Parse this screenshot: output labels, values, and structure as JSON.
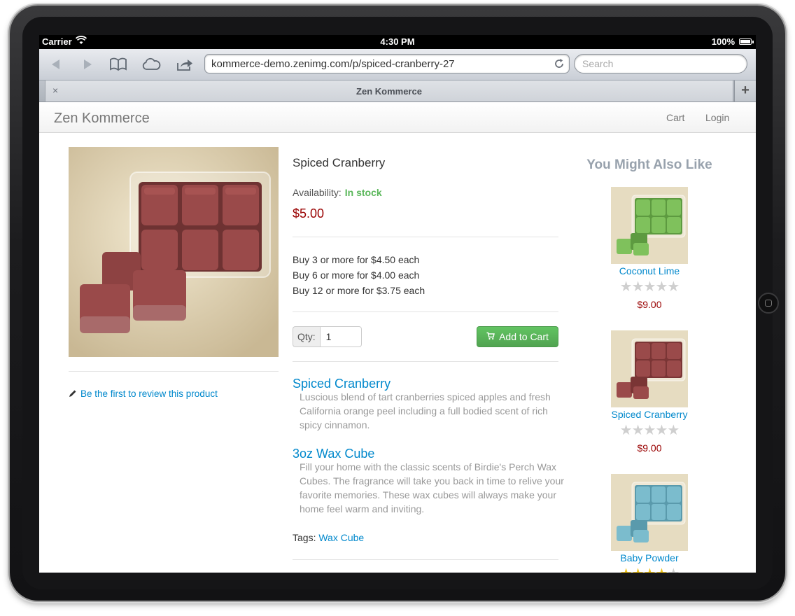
{
  "statusbar": {
    "carrier": "Carrier",
    "time": "4:30 PM",
    "battery": "100%"
  },
  "browser": {
    "url": "kommerce-demo.zenimg.com/p/spiced-cranberry-27",
    "search_placeholder": "Search",
    "tab_title": "Zen Kommerce",
    "tab_close": "×",
    "tab_add": "+"
  },
  "navbar": {
    "brand": "Zen Kommerce",
    "cart": "Cart",
    "login": "Login"
  },
  "product": {
    "title": "Spiced Cranberry",
    "availability_label": "Availability:",
    "availability_value": "In stock",
    "price": "$5.00",
    "tiers": [
      "Buy 3 or more for $4.50 each",
      "Buy 6 or more for $4.00 each",
      "Buy 12 or more for $3.75 each"
    ],
    "qty_label": "Qty:",
    "qty_value": "1",
    "add_to_cart": "Add to Cart",
    "review_link": "Be the first to review this product",
    "options": [
      {
        "title": "Spiced Cranberry",
        "text": "Luscious blend of tart cranberries spiced apples and fresh California orange peel including a full bodied scent of rich spicy cinnamon."
      },
      {
        "title": "3oz Wax Cube",
        "text": "Fill your home with the classic scents of Birdie's Perch Wax Cubes. The fragrance will take you back in time to relive your favorite memories. These wax cubes will always make your home feel warm and inviting."
      }
    ],
    "tags_label": "Tags:",
    "tag": "Wax Cube",
    "colors": {
      "cube": "#9a4a4a",
      "cube_dark": "#7a3535",
      "background": "#e8dcbd"
    }
  },
  "related": {
    "title": "You Might Also Like",
    "items": [
      {
        "name": "Coconut Lime",
        "price": "$9.00",
        "rating": 0,
        "color": "#7fc15c",
        "dark": "#5d9a40"
      },
      {
        "name": "Spiced Cranberry",
        "price": "$9.00",
        "rating": 0,
        "color": "#9a4a4a",
        "dark": "#7a3535"
      },
      {
        "name": "Baby Powder",
        "rating": 4,
        "color": "#7bbccd",
        "dark": "#5a9aac"
      }
    ]
  }
}
